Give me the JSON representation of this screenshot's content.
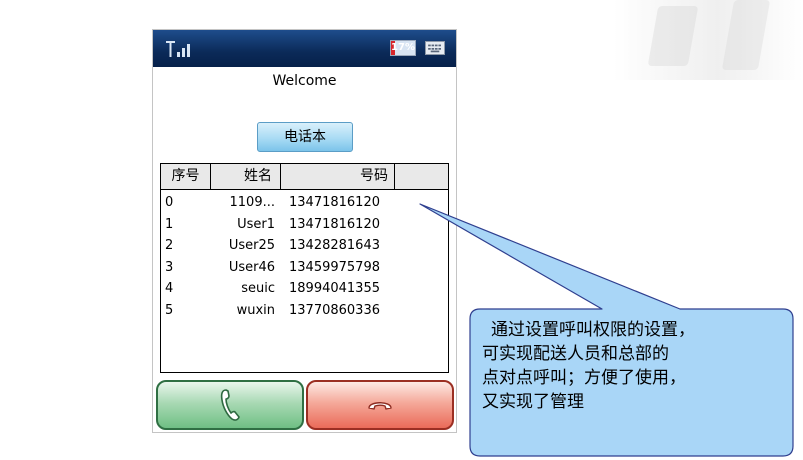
{
  "status_bar": {
    "battery_label": "17%",
    "battery_level": 0.17,
    "signal_icon": "signal-bars-icon",
    "keyboard_icon": "keyboard-icon"
  },
  "welcome": "Welcome",
  "phonebook_button": "电话本",
  "table": {
    "headers": {
      "index": "序号",
      "name": "姓名",
      "number": "号码"
    },
    "rows": [
      {
        "index": "0",
        "name": "1109...",
        "number": "13471816120"
      },
      {
        "index": "1",
        "name": "User1",
        "number": "13471816120"
      },
      {
        "index": "2",
        "name": "User25",
        "number": "13428281643"
      },
      {
        "index": "3",
        "name": "User46",
        "number": "13459975798"
      },
      {
        "index": "4",
        "name": "seuic",
        "number": "18994041355"
      },
      {
        "index": "5",
        "name": "wuxin",
        "number": "13770860336"
      }
    ]
  },
  "buttons": {
    "call_icon": "phone-handset-icon",
    "hangup_icon": "hang-up-icon"
  },
  "callout": {
    "lines": [
      "通过设置呼叫权限的设置，",
      "可实现配送人员和总部的",
      "点对点呼叫；方便了使用，",
      "又实现了管理"
    ]
  },
  "colors": {
    "status_bar": "#0b2a58",
    "call_button": "#6fbf84",
    "hangup_button": "#ea6b59",
    "callout_fill": "#a9d6f7",
    "callout_border": "#2f3f8f"
  }
}
